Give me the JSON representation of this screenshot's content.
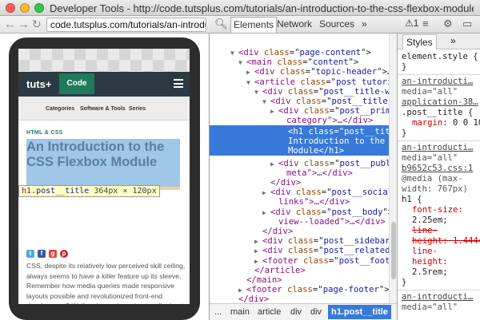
{
  "window": {
    "title": "Developer Tools - http://code.tutsplus.com/tutorials/an-introduction-to-the-css-flexbox-module--net-37..."
  },
  "browser": {
    "back_icon": "arrow-left-icon",
    "forward_icon": "arrow-right-icon",
    "reload_icon": "reload-icon",
    "url": "code.tutsplus.com/tutorials/an-introduction-to-the-css-flexbox-module"
  },
  "site": {
    "logo": "tuts+",
    "code_tab": "Code",
    "subnav": [
      "Categories",
      "Software & Tools",
      "Series"
    ],
    "category": "HTML & CSS",
    "title": "An Introduction to the CSS Flexbox Module",
    "tooltip": {
      "tag": "h1",
      "cls": ".post__title",
      "size": "364px × 120px"
    },
    "social_icons": [
      "twitter-icon",
      "facebook-icon",
      "google-plus-icon",
      "pinterest-icon"
    ],
    "body": "CSS, despite its relatively low perceived skill ceiling, always seems to have a killer feature up its sleeve. Remember how media queries made responsive layouts possible and revolutionized front-end development? Well, today, we're going to talk about a new layout mode, called flexbox - new"
  },
  "devtools": {
    "toolbar": {
      "tabs": [
        "Elements",
        "Network",
        "Sources"
      ],
      "more": "»",
      "warnings": "1",
      "settings_icon": "gear-icon",
      "dock_icon": "dock-icon"
    },
    "tree": [
      {
        "indent": 0,
        "arrow": "▼",
        "tag": "div",
        "attr": "class",
        "val": "page-content",
        "close": ""
      },
      {
        "indent": 1,
        "arrow": "▼",
        "tag": "main",
        "attr": "class",
        "val": "content",
        "close": ""
      },
      {
        "indent": 2,
        "arrow": "▶",
        "tag": "div",
        "attr": "class",
        "val": "topic-header",
        "close": "…</div>"
      },
      {
        "indent": 2,
        "arrow": "▼",
        "tag": "article",
        "attr": "class",
        "val": "post tutorial",
        "close": ""
      },
      {
        "indent": 3,
        "arrow": "▼",
        "tag": "div",
        "attr": "class",
        "val": "post__title-wrapper",
        "close": ""
      },
      {
        "indent": 4,
        "arrow": "▼",
        "tag": "div",
        "attr": "class",
        "val": "post__title",
        "close": ""
      },
      {
        "indent": 5,
        "arrow": "▶",
        "tag": "div",
        "attr": "class",
        "val": "post__primary-",
        "close": ""
      },
      {
        "indent": 6,
        "arrow": "",
        "tag": "",
        "attr": "",
        "val": "",
        "close": "",
        "text": "category\">…</div>"
      }
    ],
    "selected": [
      "<h1 class=\"post__title\">",
      "Introduction to the C",
      "Module</h1>"
    ],
    "tree_after": [
      {
        "indent": 5,
        "arrow": "▶",
        "tag": "div",
        "attr": "class",
        "val": "post__publish-",
        "close": ""
      },
      {
        "indent": 6,
        "arrow": "",
        "tag": "",
        "attr": "",
        "val": "",
        "close": "",
        "text": "meta\">…</div>"
      },
      {
        "indent": 4,
        "arrow": "",
        "tag": "",
        "attr": "",
        "val": "",
        "close": "",
        "text": "</div>"
      },
      {
        "indent": 4,
        "arrow": "▶",
        "tag": "div",
        "attr": "class",
        "val": "post__social-",
        "close": ""
      },
      {
        "indent": 5,
        "arrow": "",
        "tag": "",
        "attr": "",
        "val": "",
        "close": "",
        "text": "links\">…</div>"
      },
      {
        "indent": 4,
        "arrow": "▶",
        "tag": "div",
        "attr": "class",
        "val": "post__body",
        "close": ""
      },
      {
        "indent": 5,
        "arrow": "",
        "tag": "",
        "attr": "",
        "val": "",
        "close": "",
        "text": "view--loaded\">…</div>"
      },
      {
        "indent": 3,
        "arrow": "",
        "tag": "",
        "attr": "",
        "val": "",
        "close": "",
        "text": "</div>"
      },
      {
        "indent": 3,
        "arrow": "▶",
        "tag": "div",
        "attr": "class",
        "val": "post__sidebar",
        "close": ""
      },
      {
        "indent": 3,
        "arrow": "▶",
        "tag": "div",
        "attr": "class",
        "val": "post__related",
        "close": ""
      },
      {
        "indent": 3,
        "arrow": "▶",
        "tag": "footer",
        "attr": "class",
        "val": "post__footer",
        "close": ""
      },
      {
        "indent": 2,
        "arrow": "",
        "tag": "",
        "attr": "",
        "val": "",
        "close": "",
        "text": "</article>"
      },
      {
        "indent": 1,
        "arrow": "",
        "tag": "",
        "attr": "",
        "val": "",
        "close": "",
        "text": "</main>"
      },
      {
        "indent": 1,
        "arrow": "▶",
        "tag": "footer",
        "attr": "class",
        "val": "page-footer",
        "close": "…"
      },
      {
        "indent": 0,
        "arrow": "",
        "tag": "",
        "attr": "",
        "val": "",
        "close": "",
        "text": "</div>"
      },
      {
        "indent": 0,
        "arrow": "",
        "tag": "",
        "attr": "",
        "val": "",
        "close": "",
        "text": "</div>"
      }
    ],
    "breadcrumbs": [
      "...",
      "main",
      "article",
      "div",
      "div",
      "h1.post__title"
    ],
    "styles": {
      "tab": "Styles",
      "more": "»",
      "lines": [
        {
          "kind": "text",
          "text": "element.style {"
        },
        {
          "kind": "text",
          "text": "}"
        },
        {
          "kind": "div"
        },
        {
          "kind": "link",
          "text": "an-introducti…"
        },
        {
          "kind": "media",
          "text": "media=\"all\""
        },
        {
          "kind": "link",
          "text": "application-38…"
        },
        {
          "kind": "text",
          "text": ".post__title {"
        },
        {
          "kind": "prop",
          "prop": "margin",
          "value": "0 0 10px;"
        },
        {
          "kind": "text",
          "text": "}"
        },
        {
          "kind": "div"
        },
        {
          "kind": "link",
          "text": "an-introducti…"
        },
        {
          "kind": "media",
          "text": "media=\"all\""
        },
        {
          "kind": "link",
          "text": "b9652c53.css:1"
        },
        {
          "kind": "media",
          "text": "@media (max-"
        },
        {
          "kind": "media",
          "text": "width: 767px)"
        },
        {
          "kind": "text",
          "text": "h1 {"
        },
        {
          "kind": "prop",
          "prop": "font-size",
          "value": ""
        },
        {
          "kind": "value",
          "text": "2.25em;"
        },
        {
          "kind": "strike",
          "text": "line-"
        },
        {
          "kind": "strike",
          "text": "height: 1.44444…"
        },
        {
          "kind": "prop",
          "prop": "line-",
          "value": ""
        },
        {
          "kind": "prop",
          "prop": "height",
          "value": ""
        },
        {
          "kind": "value",
          "text": "2.5rem;"
        },
        {
          "kind": "text",
          "text": "}"
        },
        {
          "kind": "div"
        },
        {
          "kind": "link",
          "text": "an-introducti…"
        },
        {
          "kind": "media",
          "text": "media=\"all\""
        }
      ]
    }
  }
}
